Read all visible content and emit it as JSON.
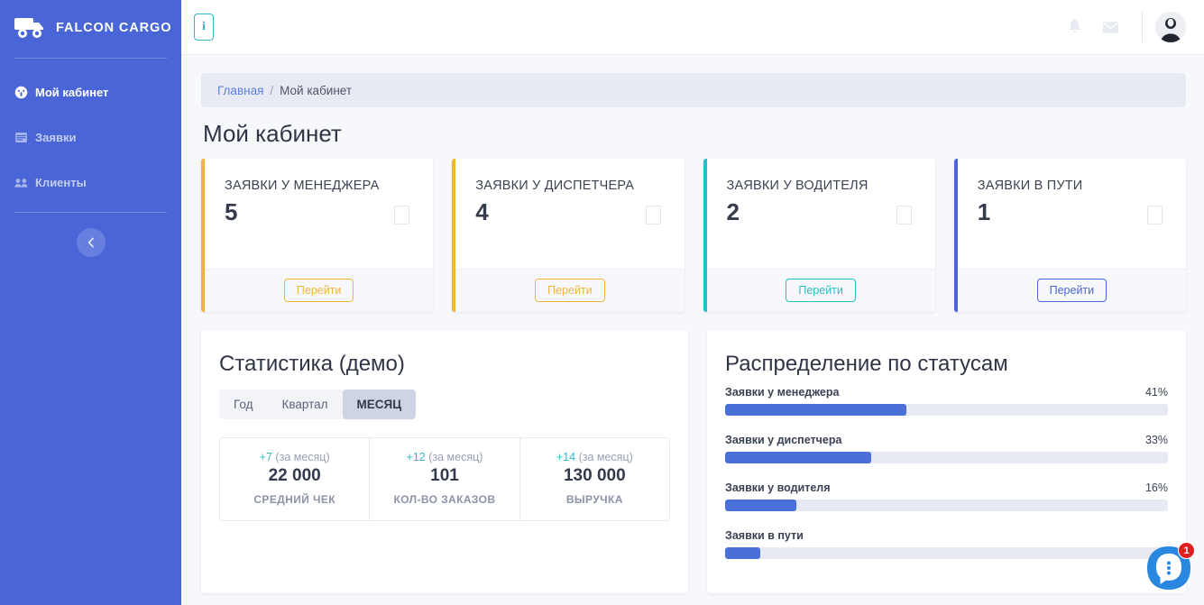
{
  "sidebar": {
    "brand": "FALCON CARGO",
    "brand_logo_icon": "truck-icon",
    "items": [
      {
        "label": "Мой кабинет",
        "icon": "dashboard-icon",
        "active": true
      },
      {
        "label": "Заявки",
        "icon": "clipboard-list-icon",
        "active": false
      },
      {
        "label": "Клиенты",
        "icon": "users-icon",
        "active": false
      }
    ],
    "collapse_icon": "chevron-left-icon"
  },
  "topbar": {
    "info_button_label": "i",
    "info_button_icon": "info-icon",
    "bell_icon": "bell-icon",
    "mail_icon": "mail-icon",
    "avatar_icon": "avatar"
  },
  "breadcrumb": {
    "home": "Главная",
    "separator": "/",
    "current": "Мой кабинет"
  },
  "page": {
    "title": "Мой кабинет"
  },
  "cards": [
    {
      "title": "ЗАЯВКИ У МЕНЕДЖЕРА",
      "value": "5",
      "button": "Перейти",
      "accent": "#f2b33d"
    },
    {
      "title": "ЗАЯВКИ У ДИСПЕТЧЕРА",
      "value": "4",
      "button": "Перейти",
      "accent": "#f2b33d"
    },
    {
      "title": "ЗАЯВКИ У ВОДИТЕЛЯ",
      "value": "2",
      "button": "Перейти",
      "accent": "#26bfc9"
    },
    {
      "title": "ЗАЯВКИ В ПУТИ",
      "value": "1",
      "button": "Перейти",
      "accent": "#4a66d6"
    }
  ],
  "stats_panel": {
    "title": "Статистика (демо)",
    "tabs": [
      {
        "label": "Год",
        "active": false
      },
      {
        "label": "Квартал",
        "active": false
      },
      {
        "label": "МЕСЯЦ",
        "active": true
      }
    ],
    "metrics": [
      {
        "delta": "+7",
        "period": "(за месяц)",
        "value": "22 000",
        "label": "СРЕДНИЙ ЧЕК"
      },
      {
        "delta": "+12",
        "period": "(за месяц)",
        "value": "101",
        "label": "КОЛ-ВО ЗАКАЗОВ"
      },
      {
        "delta": "+14",
        "period": "(за месяц)",
        "value": "130 000",
        "label": "ВЫРУЧКА"
      }
    ]
  },
  "distribution_panel": {
    "title": "Распределение по статусам",
    "rows": [
      {
        "label": "Заявки у менеджера",
        "pct": "41%",
        "width": "41%"
      },
      {
        "label": "Заявки у диспетчера",
        "pct": "33%",
        "width": "33%"
      },
      {
        "label": "Заявки у водителя",
        "pct": "16%",
        "width": "16%"
      },
      {
        "label": "Заявки в пути",
        "pct": "",
        "width": "8%"
      }
    ]
  },
  "chart_data": {
    "type": "bar",
    "title": "Распределение по статусам",
    "categories": [
      "Заявки у менеджера",
      "Заявки у диспетчера",
      "Заявки у водителя",
      "Заявки в пути"
    ],
    "values": [
      41,
      33,
      16,
      8
    ],
    "unit": "%",
    "xlim": [
      0,
      100
    ],
    "orientation": "horizontal",
    "grid": false,
    "legend": false,
    "bar_color": "#4a6fd8",
    "track_color": "#e7eaf3"
  },
  "chat_widget": {
    "badge": "1",
    "icon": "chat-bubble-icon"
  },
  "theme": {
    "sidebar_bg": "#4a66d6",
    "accent_blue": "#4a6fd8",
    "accent_teal": "#26bfc9",
    "accent_amber": "#f2b33d",
    "badge_red": "#e02020"
  }
}
